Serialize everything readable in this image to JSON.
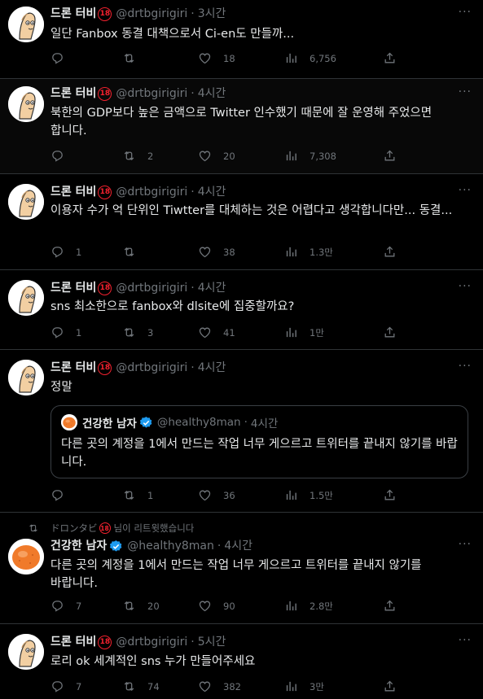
{
  "tweets": [
    {
      "name": "드론 터비",
      "handle": "@drtbgirigiri",
      "time": "3시간",
      "text": "일단 Fanbox 동결 대책으로서 Ci-en도 만들까...",
      "reply": "",
      "retweet": "",
      "like": "18",
      "views": "6,756"
    },
    {
      "name": "드론 터비",
      "handle": "@drtbgirigiri",
      "time": "4시간",
      "text": "북한의 GDP보다 높은 금액으로 Twitter 인수했기 때문에 잘 운영해 주었으면 합니다.",
      "reply": "",
      "retweet": "2",
      "like": "20",
      "views": "7,308"
    },
    {
      "name": "드론 터비",
      "handle": "@drtbgirigiri",
      "time": "4시간",
      "text": "이용자 수가 억 단위인 Tiwtter를 대체하는 것은 어렵다고 생각합니다만... 동결...",
      "reply": "1",
      "retweet": "",
      "like": "38",
      "views": "1.3만"
    },
    {
      "name": "드론 터비",
      "handle": "@drtbgirigiri",
      "time": "4시간",
      "text": "sns 최소한으로 fanbox와 dlsite에 집중할까요?",
      "reply": "1",
      "retweet": "3",
      "like": "41",
      "views": "1만"
    },
    {
      "name": "드론 터비",
      "handle": "@drtbgirigiri",
      "time": "4시간",
      "text": "정말",
      "reply": "",
      "retweet": "1",
      "like": "36",
      "views": "1.5만",
      "quote": {
        "name": "건강한 남자",
        "handle": "@healthy8man",
        "time": "4시간",
        "text": "다른 곳의 계정을 1에서 만드는 작업 너무 게으르고 트위터를 끝내지 않기를 바랍니다."
      }
    },
    {
      "retweeted_by": "ドロンタビ",
      "retweeted_suffix": "님이 리트윗했습니다",
      "name": "건강한 남자",
      "handle": "@healthy8man",
      "time": "4시간",
      "text": "다른 곳의 계정을 1에서 만드는 작업 너무 게으르고 트위터를 끝내지 않기를 바랍니다.",
      "reply": "7",
      "retweet": "20",
      "like": "90",
      "views": "2.8만"
    },
    {
      "name": "드론 터비",
      "handle": "@drtbgirigiri",
      "time": "5시간",
      "text": "로리 ok 세계적인 sns 누가 만들어주세요",
      "reply": "7",
      "retweet": "74",
      "like": "382",
      "views": "3만"
    }
  ],
  "badge_text": "18",
  "dot": "·",
  "more": "···",
  "colors": {
    "background": "#000000",
    "text": "#e7e9ea",
    "muted": "#71767b",
    "badge_red": "#f4212e",
    "verified_blue": "#1d9bf0",
    "divider": "#2f3336"
  },
  "icons": [
    "reply-icon",
    "retweet-icon",
    "like-icon",
    "views-icon",
    "share-icon",
    "verified-icon",
    "more-icon"
  ]
}
